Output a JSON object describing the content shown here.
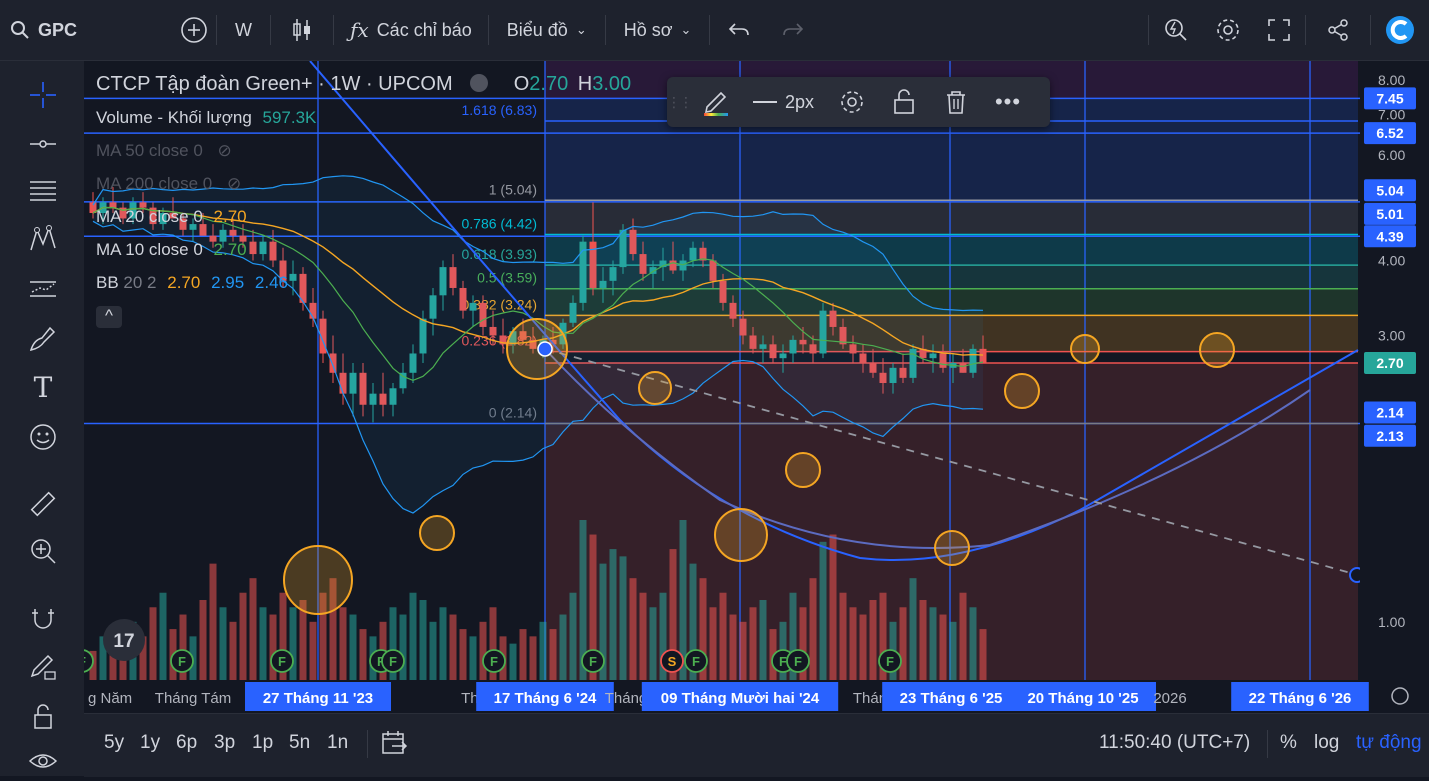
{
  "topbar": {
    "symbol": "GPC",
    "interval": "W",
    "indicators_label": "Các chỉ báo",
    "chart_label": "Biểu đồ",
    "profile_label": "Hồ sơ"
  },
  "legend": {
    "title": "CTCP Tập đoàn Green+ · 1W · UPCOM",
    "ohlc_o_label": "O",
    "ohlc_o": "2.70",
    "ohlc_h_label": "H",
    "ohlc_h": "3.00",
    "volume_label": "Volume - Khối lượng",
    "volume_value": "597.3K",
    "ma50": "MA 50 close 0",
    "ma200": "MA 200 close 0",
    "ma20": "MA 20 close 0",
    "ma20_value": "2.70",
    "ma10": "MA 10 close 0",
    "ma10_value": "2.70",
    "bb": "BB",
    "bb_params": "20 2",
    "bb_v1": "2.70",
    "bb_v2": "2.95",
    "bb_v3": "2.46"
  },
  "floatbar": {
    "width_label": "2px"
  },
  "bottombar": {
    "ranges": [
      "5y",
      "1y",
      "6p",
      "3p",
      "1p",
      "5n",
      "1n"
    ],
    "time": "11:50:40 (UTC+7)",
    "percent": "%",
    "log": "log",
    "auto": "tự động"
  },
  "colors": {
    "up": "#26a69a",
    "down": "#ef5350",
    "ma20": "#f5a623",
    "ma10": "#4caf50",
    "bb": "#2196f3",
    "accent": "#2962ff"
  },
  "chart_data": {
    "type": "line",
    "title": "CTCP Tập đoàn Green+ · 1W · UPCOM",
    "ylim": [
      0.8,
      8.6
    ],
    "y_ticks": [
      "1.00",
      "3.00",
      "4.00",
      "6.00",
      "7.00",
      "8.00"
    ],
    "price_badges": [
      {
        "label": "7.45",
        "value": 7.45,
        "color": "#2962ff"
      },
      {
        "label": "6.52",
        "value": 6.52,
        "color": "#2962ff"
      },
      {
        "label": "5.04",
        "value": 5.04,
        "color": "#2962ff"
      },
      {
        "label": "5.01",
        "value": 5.01,
        "color": "#2962ff"
      },
      {
        "label": "4.39",
        "value": 4.39,
        "color": "#2962ff"
      },
      {
        "label": "2.70",
        "value": 2.7,
        "color": "#26a69a"
      },
      {
        "label": "2.14",
        "value": 2.14,
        "color": "#2962ff"
      },
      {
        "label": "2.13",
        "value": 2.13,
        "color": "#2962ff"
      }
    ],
    "fib_levels": [
      {
        "label": "1.618 (6.83)",
        "value": 6.83
      },
      {
        "label": "1 (5.04)",
        "value": 5.04
      },
      {
        "label": "0.786 (4.42)",
        "value": 4.42
      },
      {
        "label": "0.618 (3.93)",
        "value": 3.93
      },
      {
        "label": "0.5 (3.59)",
        "value": 3.59
      },
      {
        "label": "0.382 (3.24)",
        "value": 3.24
      },
      {
        "label": "0.236 (2.82)",
        "value": 2.82
      },
      {
        "label": "0 (2.14)",
        "value": 2.14
      }
    ],
    "x_labels": [
      "g Năm",
      "Tháng Tám",
      "27 Tháng 11 '23",
      "Thá",
      "17 Tháng 6 '24",
      "Tháng",
      "09 Tháng Mười hai '24",
      "Thán",
      "23 Tháng 6 '25",
      "20 Tháng 10 '25",
      "2026",
      "22 Tháng 6 '26"
    ],
    "x_highlight": [
      "27 Tháng 11 '23",
      "17 Tháng 6 '24",
      "09 Tháng Mười hai '24",
      "23 Tháng 6 '25",
      "20 Tháng 10 '25",
      "22 Tháng 6 '26"
    ],
    "event_marks": [
      "F",
      "F",
      "F",
      "F",
      "F",
      "F",
      "F",
      "S",
      "F",
      "F",
      "F",
      "F",
      "F"
    ],
    "candles": [
      [
        5.0,
        5.2,
        4.7,
        4.8
      ],
      [
        4.8,
        5.1,
        4.6,
        5.0
      ],
      [
        5.0,
        5.3,
        4.8,
        4.9
      ],
      [
        4.9,
        5.0,
        4.6,
        4.7
      ],
      [
        4.7,
        5.1,
        4.6,
        5.0
      ],
      [
        5.0,
        5.2,
        4.8,
        4.9
      ],
      [
        4.9,
        5.0,
        4.5,
        4.6
      ],
      [
        4.6,
        4.9,
        4.5,
        4.8
      ],
      [
        4.8,
        5.1,
        4.7,
        4.7
      ],
      [
        4.7,
        4.8,
        4.4,
        4.5
      ],
      [
        4.5,
        4.7,
        4.3,
        4.6
      ],
      [
        4.6,
        4.8,
        4.4,
        4.4
      ],
      [
        4.4,
        4.6,
        4.2,
        4.3
      ],
      [
        4.3,
        4.6,
        4.2,
        4.5
      ],
      [
        4.5,
        4.7,
        4.3,
        4.4
      ],
      [
        4.4,
        4.6,
        4.2,
        4.3
      ],
      [
        4.3,
        4.5,
        4.0,
        4.1
      ],
      [
        4.1,
        4.4,
        4.0,
        4.3
      ],
      [
        4.3,
        4.5,
        3.9,
        4.0
      ],
      [
        4.0,
        4.2,
        3.6,
        3.7
      ],
      [
        3.7,
        4.0,
        3.5,
        3.8
      ],
      [
        3.8,
        3.9,
        3.3,
        3.4
      ],
      [
        3.4,
        3.6,
        3.1,
        3.2
      ],
      [
        3.2,
        3.3,
        2.7,
        2.8
      ],
      [
        2.8,
        3.0,
        2.5,
        2.6
      ],
      [
        2.6,
        2.8,
        2.3,
        2.4
      ],
      [
        2.4,
        2.7,
        2.2,
        2.6
      ],
      [
        2.6,
        2.7,
        2.2,
        2.3
      ],
      [
        2.3,
        2.5,
        2.15,
        2.4
      ],
      [
        2.4,
        2.6,
        2.2,
        2.3
      ],
      [
        2.3,
        2.5,
        2.2,
        2.45
      ],
      [
        2.45,
        2.7,
        2.4,
        2.6
      ],
      [
        2.6,
        2.9,
        2.5,
        2.8
      ],
      [
        2.8,
        3.3,
        2.7,
        3.2
      ],
      [
        3.2,
        3.6,
        3.0,
        3.5
      ],
      [
        3.5,
        4.0,
        3.3,
        3.9
      ],
      [
        3.9,
        4.1,
        3.5,
        3.6
      ],
      [
        3.6,
        3.7,
        3.2,
        3.3
      ],
      [
        3.3,
        3.5,
        3.1,
        3.4
      ],
      [
        3.4,
        3.5,
        3.0,
        3.1
      ],
      [
        3.1,
        3.3,
        2.9,
        3.0
      ],
      [
        3.0,
        3.2,
        2.8,
        2.9
      ],
      [
        2.9,
        3.1,
        2.8,
        3.05
      ],
      [
        3.05,
        3.2,
        2.9,
        2.95
      ],
      [
        2.95,
        3.1,
        2.8,
        2.85
      ],
      [
        2.85,
        3.0,
        2.75,
        2.95
      ],
      [
        2.95,
        3.1,
        2.8,
        2.9
      ],
      [
        2.9,
        3.2,
        2.85,
        3.15
      ],
      [
        3.15,
        3.5,
        3.1,
        3.4
      ],
      [
        3.4,
        4.4,
        3.3,
        4.3
      ],
      [
        4.3,
        5.0,
        3.5,
        3.6
      ],
      [
        3.6,
        3.9,
        3.4,
        3.7
      ],
      [
        3.7,
        4.0,
        3.5,
        3.9
      ],
      [
        3.9,
        4.6,
        3.8,
        4.5
      ],
      [
        4.5,
        4.7,
        4.0,
        4.1
      ],
      [
        4.1,
        4.3,
        3.7,
        3.8
      ],
      [
        3.8,
        4.0,
        3.6,
        3.9
      ],
      [
        3.9,
        4.2,
        3.7,
        4.0
      ],
      [
        4.0,
        4.3,
        3.8,
        3.85
      ],
      [
        3.85,
        4.1,
        3.7,
        4.0
      ],
      [
        4.0,
        4.3,
        3.9,
        4.2
      ],
      [
        4.2,
        4.3,
        3.9,
        4.0
      ],
      [
        4.0,
        4.1,
        3.6,
        3.7
      ],
      [
        3.7,
        3.8,
        3.3,
        3.4
      ],
      [
        3.4,
        3.5,
        3.1,
        3.2
      ],
      [
        3.2,
        3.3,
        2.9,
        3.0
      ],
      [
        3.0,
        3.1,
        2.8,
        2.85
      ],
      [
        2.85,
        3.0,
        2.7,
        2.9
      ],
      [
        2.9,
        3.0,
        2.7,
        2.75
      ],
      [
        2.75,
        2.9,
        2.6,
        2.8
      ],
      [
        2.8,
        3.0,
        2.7,
        2.95
      ],
      [
        2.95,
        3.1,
        2.8,
        2.9
      ],
      [
        2.9,
        3.0,
        2.7,
        2.8
      ],
      [
        2.8,
        3.4,
        2.75,
        3.3
      ],
      [
        3.3,
        3.4,
        3.0,
        3.1
      ],
      [
        3.1,
        3.2,
        2.85,
        2.9
      ],
      [
        2.9,
        3.0,
        2.7,
        2.8
      ],
      [
        2.8,
        2.9,
        2.6,
        2.7
      ],
      [
        2.7,
        2.85,
        2.55,
        2.6
      ],
      [
        2.6,
        2.75,
        2.4,
        2.5
      ],
      [
        2.5,
        2.7,
        2.4,
        2.65
      ],
      [
        2.65,
        2.8,
        2.5,
        2.55
      ],
      [
        2.55,
        2.9,
        2.5,
        2.85
      ],
      [
        2.85,
        3.0,
        2.7,
        2.75
      ],
      [
        2.75,
        2.9,
        2.6,
        2.8
      ],
      [
        2.8,
        2.9,
        2.6,
        2.65
      ],
      [
        2.65,
        2.8,
        2.5,
        2.7
      ],
      [
        2.7,
        2.85,
        2.6,
        2.6
      ],
      [
        2.6,
        2.9,
        2.55,
        2.85
      ],
      [
        2.85,
        3.0,
        2.7,
        2.7
      ]
    ],
    "volumes": [
      0.2,
      0.3,
      0.25,
      0.35,
      0.4,
      0.3,
      0.5,
      0.6,
      0.35,
      0.45,
      0.3,
      0.55,
      0.8,
      0.5,
      0.4,
      0.6,
      0.7,
      0.5,
      0.45,
      0.6,
      0.5,
      0.55,
      0.4,
      0.6,
      0.7,
      0.5,
      0.45,
      0.35,
      0.3,
      0.4,
      0.5,
      0.45,
      0.6,
      0.55,
      0.4,
      0.5,
      0.45,
      0.35,
      0.3,
      0.4,
      0.5,
      0.3,
      0.25,
      0.35,
      0.3,
      0.4,
      0.35,
      0.45,
      0.6,
      1.1,
      1.0,
      0.8,
      0.9,
      0.85,
      0.7,
      0.6,
      0.5,
      0.6,
      0.9,
      1.1,
      0.8,
      0.7,
      0.5,
      0.6,
      0.45,
      0.4,
      0.5,
      0.55,
      0.35,
      0.4,
      0.6,
      0.5,
      0.7,
      0.95,
      1.0,
      0.6,
      0.5,
      0.45,
      0.55,
      0.6,
      0.4,
      0.5,
      0.7,
      0.55,
      0.5,
      0.45,
      0.4,
      0.6,
      0.5,
      0.35
    ]
  }
}
